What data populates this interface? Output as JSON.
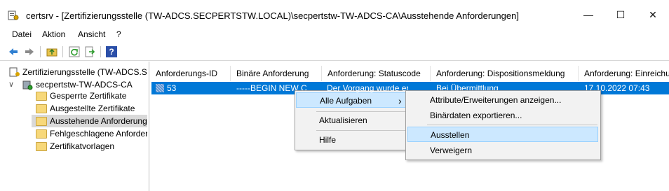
{
  "window": {
    "title": "certsrv - [Zertifizierungsstelle (TW-ADCS.SECPERTSTW.LOCAL)\\secpertstw-TW-ADCS-CA\\Ausstehende Anforderungen]",
    "minimize": "—",
    "maximize": "☐",
    "close": "✕"
  },
  "menu": [
    "Datei",
    "Aktion",
    "Ansicht",
    "?"
  ],
  "toolbar": {
    "icons": [
      "back-icon",
      "forward-icon",
      "up-folder-icon",
      "refresh-icon",
      "export-icon",
      "help-icon"
    ],
    "help_label": "?"
  },
  "tree": {
    "root": "Zertifizierungsstelle (TW-ADCS.SECPERTSTW.LOCAL)",
    "ca": "secpertstw-TW-ADCS-CA",
    "expander": "∨",
    "folders": [
      "Gesperrte Zertifikate",
      "Ausgestellte Zertifikate",
      "Ausstehende Anforderungen",
      "Fehlgeschlagene Anforderungen",
      "Zertifikatvorlagen"
    ]
  },
  "list": {
    "columns": [
      "Anforderungs-ID",
      "Binäre Anforderung",
      "Anforderung: Statuscode",
      "Anforderung: Dispositionsmeldung",
      "Anforderung: Einreichungsdatum"
    ],
    "rows": [
      {
        "id": "53",
        "binary": "-----BEGIN NEW CERTIFICATE REQUEST-----",
        "status": "Der Vorgang wurde erfolgreich beendet.",
        "disposition": "Bei Übermittlung",
        "date": "17.10.2022 07:43"
      }
    ]
  },
  "context_menu": {
    "items": [
      "Alle Aufgaben",
      "Aktualisieren",
      "Hilfe"
    ],
    "submenu_arrow": "›"
  },
  "submenu": {
    "items": [
      "Attribute/Erweiterungen anzeigen...",
      "Binärdaten exportieren...",
      "Ausstellen",
      "Verweigern"
    ]
  },
  "colors": {
    "selection": "#0078d7",
    "menu_highlight": "#cce8ff",
    "menu_bg": "#f2f2f2"
  }
}
